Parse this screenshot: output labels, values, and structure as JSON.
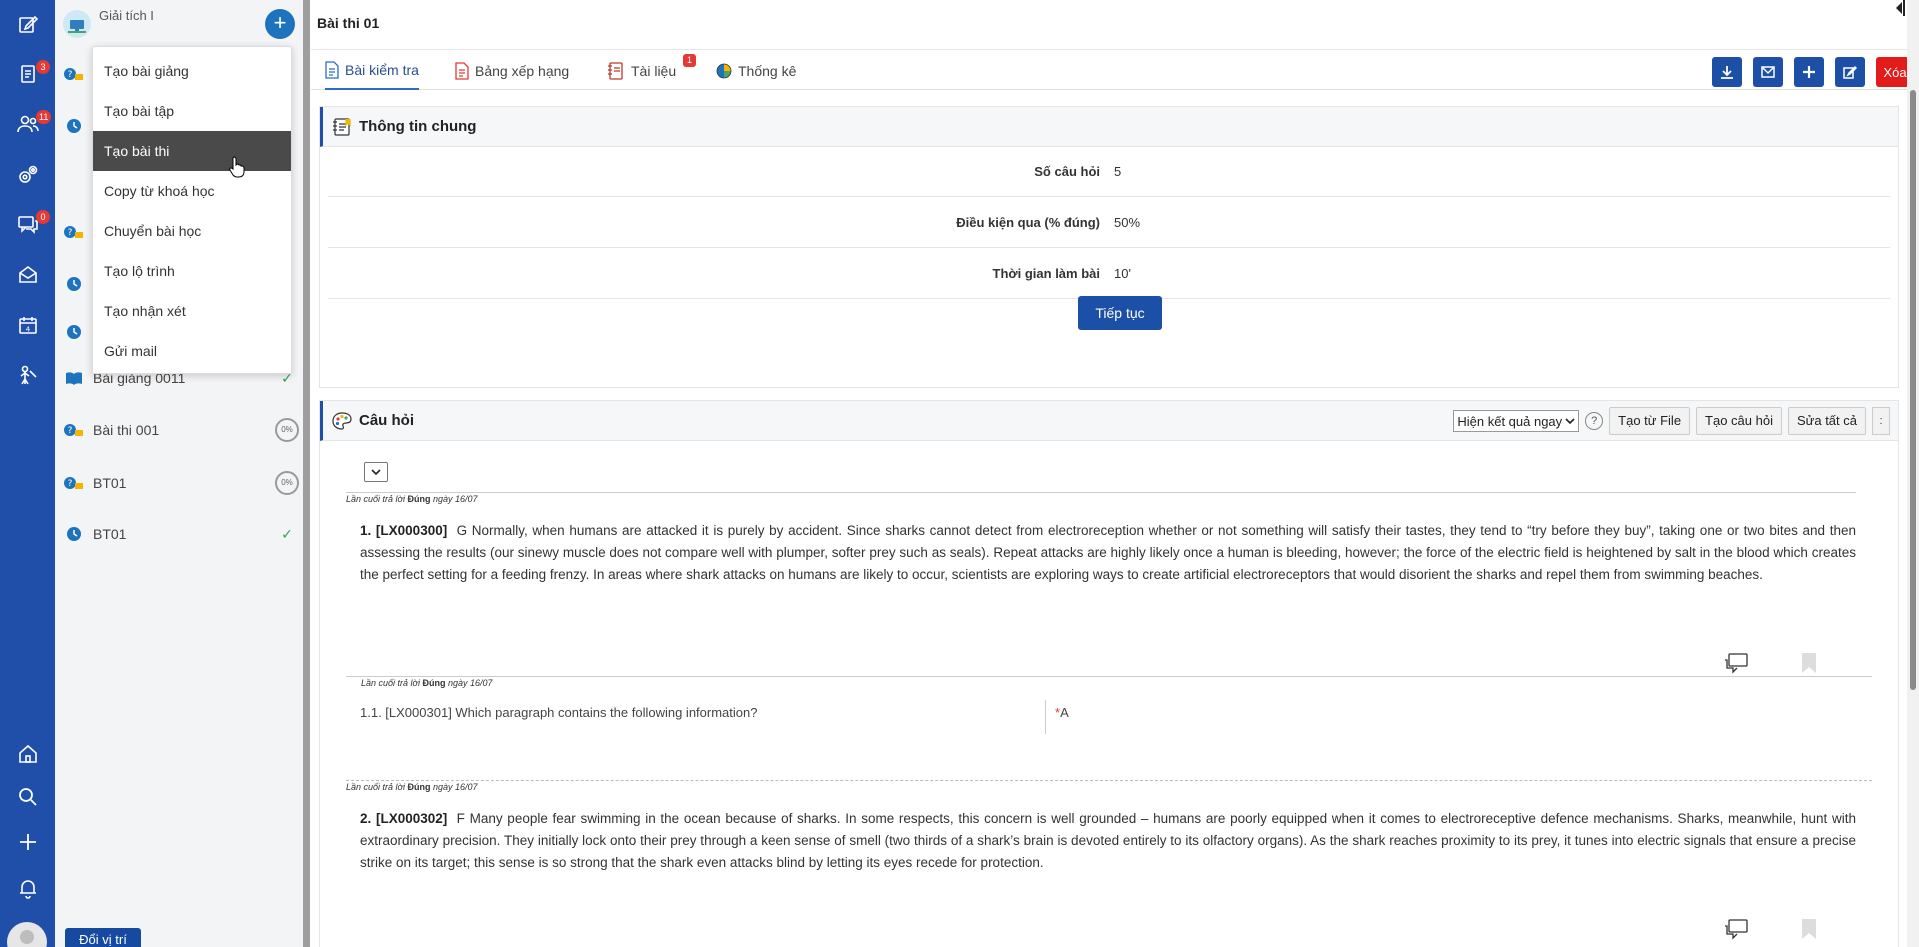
{
  "rail": {
    "badges": {
      "documents": "3",
      "users": "11",
      "messages": "0"
    }
  },
  "course": {
    "title": "Giải tích I",
    "add_label": "+",
    "lessons": [
      {
        "label": "Bài giảng 0011",
        "status": "done"
      },
      {
        "label": "Bài thi 001",
        "progress": "0%"
      },
      {
        "label": "BT01",
        "progress": "0%"
      },
      {
        "label": "BT01",
        "status": "done"
      }
    ],
    "change_position_label": "Đổi vị trí"
  },
  "dropdown": {
    "items": [
      "Tạo bài giảng",
      "Tạo bài tập",
      "Tạo bài thi",
      "Copy từ khoá học",
      "Chuyển bài học",
      "Tạo lộ trình",
      "Tạo nhận xét",
      "Gửi mail"
    ],
    "active_index": 2
  },
  "main": {
    "title": "Bài thi 01",
    "tabs": [
      {
        "label": "Bài kiểm tra"
      },
      {
        "label": "Bảng xếp hạng"
      },
      {
        "label": "Tài liệu",
        "badge": "1"
      },
      {
        "label": "Thống kê"
      }
    ],
    "delete_label": "Xóa"
  },
  "info": {
    "title": "Thông tin chung",
    "rows": [
      {
        "label": "Số câu hỏi",
        "value": "5"
      },
      {
        "label": "Điều kiện qua (% đúng)",
        "value": "50%"
      },
      {
        "label": "Thời gian làm bài",
        "value": "10'"
      }
    ],
    "continue_label": "Tiếp tục"
  },
  "questions": {
    "title": "Câu hỏi",
    "result_mode": "Hiện kết quả ngay",
    "help_label": "?",
    "from_file_label": "Tạo từ File",
    "create_label": "Tạo câu hỏi",
    "edit_all_label": "Sửa tất cả",
    "more_label": ":",
    "meta_prefix": "Lần cuối trả lời",
    "meta_status": "Đúng",
    "meta_date": "ngày 16/07",
    "q1": {
      "number": "1. [LX000300]",
      "text": "G Normally, when humans are attacked it is purely by accident. Since sharks cannot detect from electroreception whether or not something will satisfy their tastes, they tend to “try before they buy”, taking one or two bites and then assessing the results (our sinewy muscle does not compare well with plumper, softer prey such as seals). Repeat attacks are highly likely once a human is bleeding, however; the force of the electric field is heightened by salt in the blood which creates the perfect setting for a feeding frenzy. In areas where shark attacks on humans are likely to occur, scientists are exploring ways to create artificial electroreceptors that would disorient the sharks and repel them from swimming beaches."
    },
    "sub1": {
      "text": "1.1. [LX000301] Which paragraph contains the following information?",
      "answer_marker": "*",
      "answer": "A"
    },
    "q2": {
      "number": "2. [LX000302]",
      "text": "F Many people fear swimming in the ocean because of sharks. In some respects, this concern is well grounded – humans are poorly equipped when it comes to electroreceptive defence mechanisms. Sharks, meanwhile, hunt with extraordinary precision. They initially lock onto their prey through a keen sense of smell (two thirds of a shark’s brain is devoted entirely to its olfactory organs). As the shark reaches proximity to its prey, it tunes into electric signals that ensure a precise strike on its target; this sense is so strong that the shark even attacks blind by letting its eyes recede for protection."
    }
  }
}
